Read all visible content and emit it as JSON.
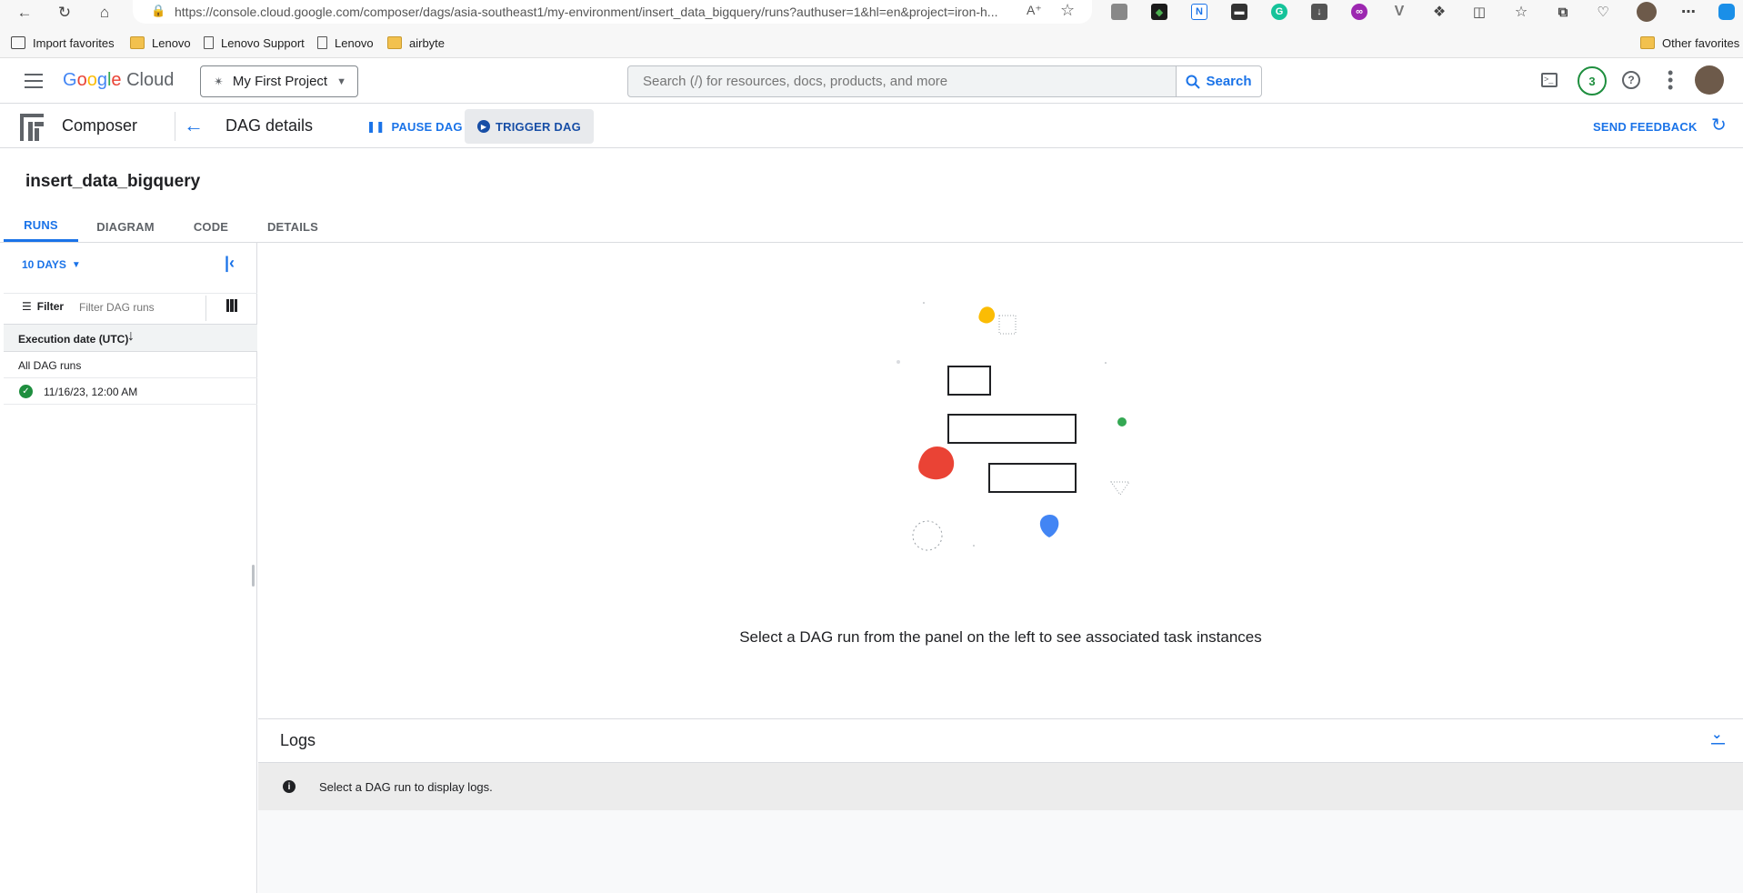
{
  "browser": {
    "url": "https://console.cloud.google.com/composer/dags/asia-southeast1/my-environment/insert_data_bigquery/runs?authuser=1&hl=en&project=iron-h...",
    "bookmarks": [
      {
        "label": "Import favorites",
        "icon": "import-icon"
      },
      {
        "label": "Lenovo",
        "icon": "folder-icon"
      },
      {
        "label": "Lenovo Support",
        "icon": "page-icon"
      },
      {
        "label": "Lenovo",
        "icon": "page-icon"
      },
      {
        "label": "airbyte",
        "icon": "folder-icon"
      }
    ],
    "other_favorites": "Other favorites"
  },
  "header": {
    "brand": "Google Cloud",
    "project": "My First Project",
    "search_placeholder": "Search (/) for resources, docs, products, and more",
    "search_label": "Search",
    "notification_count": "3"
  },
  "composer": {
    "product": "Composer",
    "page_title": "DAG details",
    "pause_label": "PAUSE DAG",
    "trigger_label": "TRIGGER DAG",
    "feedback_label": "SEND FEEDBACK"
  },
  "dag": {
    "name": "insert_data_bigquery",
    "tabs": [
      "RUNS",
      "DIAGRAM",
      "CODE",
      "DETAILS"
    ]
  },
  "runs": {
    "range_label": "10 DAYS",
    "filter_label": "Filter",
    "filter_placeholder": "Filter DAG runs",
    "column_header": "Execution date (UTC)",
    "all_runs_label": "All DAG runs",
    "items": [
      {
        "date": "11/16/23, 12:00 AM",
        "status": "success",
        "status_color": "#1e8e3e"
      }
    ]
  },
  "main": {
    "empty_message": "Select a DAG run from the panel on the left to see associated task instances"
  },
  "logs": {
    "title": "Logs",
    "info_message": "Select a DAG run to display logs."
  },
  "colors": {
    "accent": "#1a73e8",
    "success": "#1e8e3e",
    "google_yellow": "#fbbc04",
    "google_red": "#ea4335",
    "google_blue": "#4285f4",
    "google_green": "#34a853"
  }
}
